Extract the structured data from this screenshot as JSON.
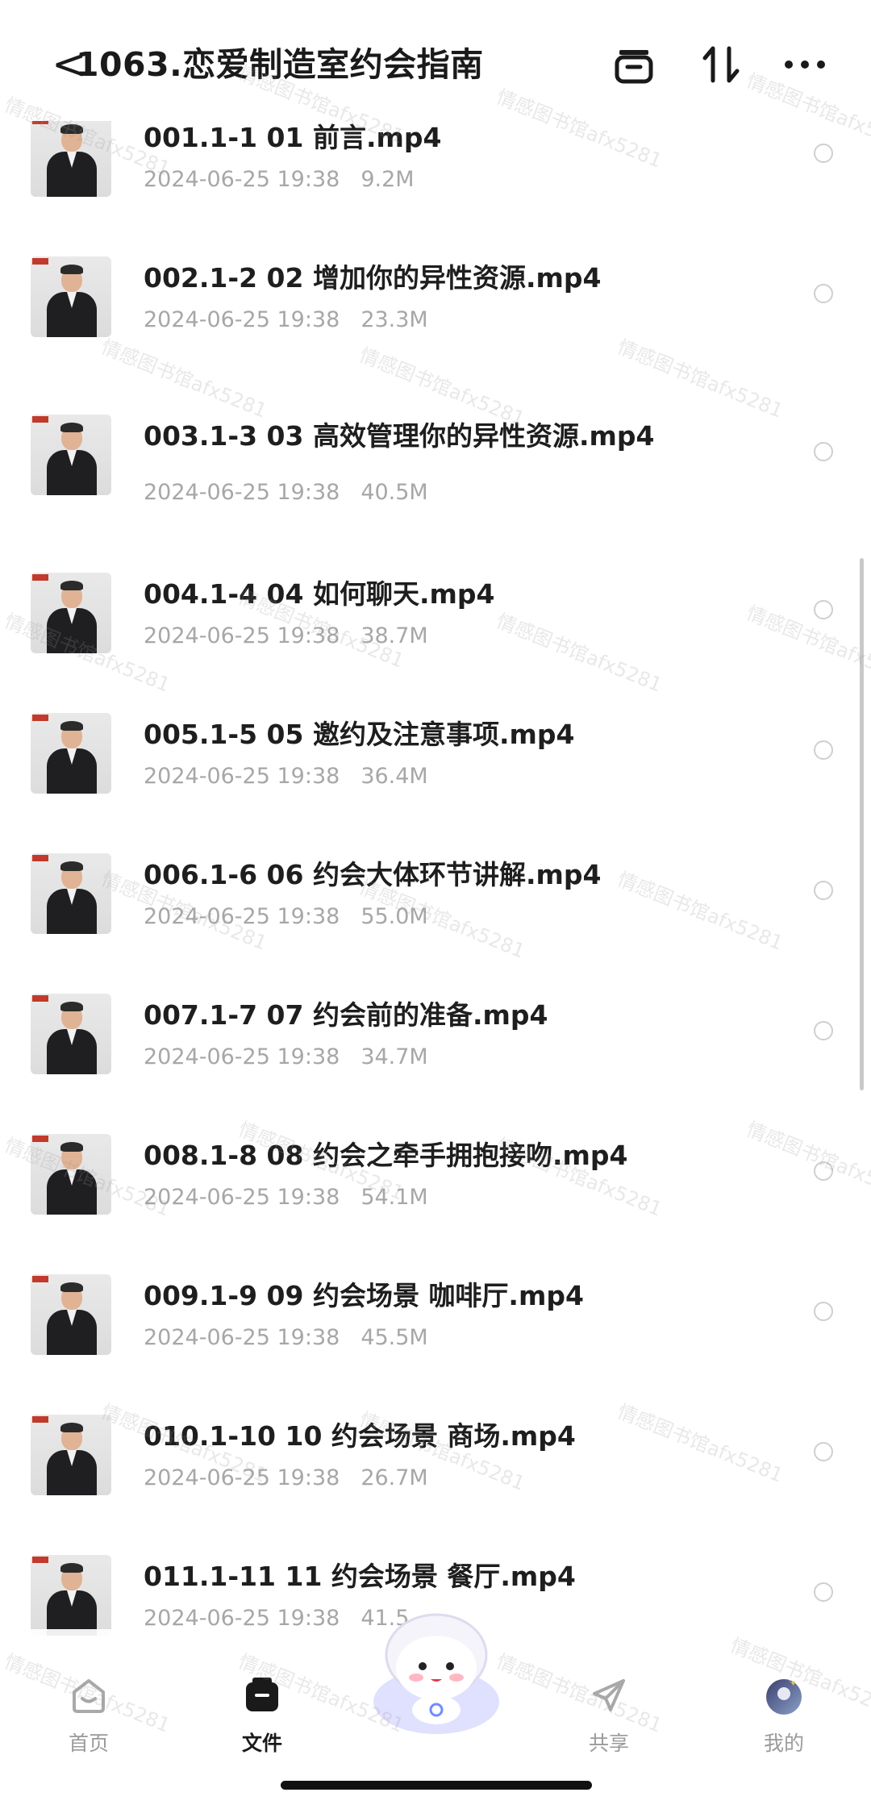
{
  "header": {
    "back_glyph": "<",
    "title": "1063.恋爱制造室约会指南",
    "icons": [
      "save-to-album-icon",
      "sort-icon",
      "more-icon"
    ]
  },
  "files": [
    {
      "name": "001.1-1 01 前言.mp4",
      "date": "2024-06-25 19:38",
      "size": "9.2M"
    },
    {
      "name": "002.1-2 02 增加你的异性资源.mp4",
      "date": "2024-06-25 19:38",
      "size": "23.3M"
    },
    {
      "name": "003.1-3 03 高效管理你的异性资源.mp4",
      "date": "2024-06-25 19:38",
      "size": "40.5M"
    },
    {
      "name": "004.1-4 04 如何聊天.mp4",
      "date": "2024-06-25 19:38",
      "size": "38.7M"
    },
    {
      "name": "005.1-5 05 邀约及注意事项.mp4",
      "date": "2024-06-25 19:38",
      "size": "36.4M"
    },
    {
      "name": "006.1-6 06 约会大体环节讲解.mp4",
      "date": "2024-06-25 19:38",
      "size": "55.0M"
    },
    {
      "name": "007.1-7 07 约会前的准备.mp4",
      "date": "2024-06-25 19:38",
      "size": "34.7M"
    },
    {
      "name": "008.1-8 08 约会之牵手拥抱接吻.mp4",
      "date": "2024-06-25 19:38",
      "size": "54.1M"
    },
    {
      "name": "009.1-9 09 约会场景 咖啡厅.mp4",
      "date": "2024-06-25 19:38",
      "size": "45.5M"
    },
    {
      "name": "010.1-10 10 约会场景 商场.mp4",
      "date": "2024-06-25 19:38",
      "size": "26.7M"
    },
    {
      "name": "011.1-11 11 约会场景 餐厅.mp4",
      "date": "2024-06-25 19:38",
      "size": "41.5"
    }
  ],
  "nav": {
    "home": "首页",
    "files": "文件",
    "share": "共享",
    "mine": "我的"
  },
  "watermark": "情感图书馆afx5281",
  "colors": {
    "text": "#1e1e1e",
    "meta": "#a7a7a7",
    "active_nav": "#1a1a1a",
    "inactive_nav": "#9a9a9a"
  }
}
